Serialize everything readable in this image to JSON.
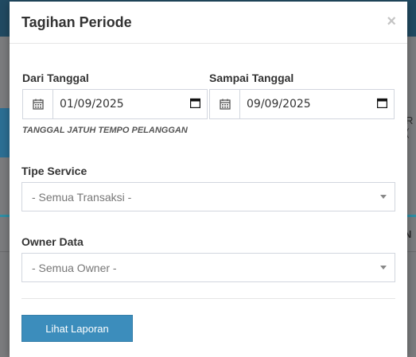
{
  "background": {
    "fragment_right_1": "R (",
    "fragment_right_2": "N I"
  },
  "modal": {
    "title": "Tagihan Periode",
    "close_label": "×"
  },
  "form": {
    "from_date": {
      "label": "Dari Tanggal",
      "value": "01/09/2025"
    },
    "to_date": {
      "label": "Sampai Tanggal",
      "value": "09/09/2025"
    },
    "help_text": "TANGGAL JATUH TEMPO PELANGGAN",
    "service_type": {
      "label": "Tipe Service",
      "selected": "- Semua Transaksi -"
    },
    "owner_data": {
      "label": "Owner Data",
      "selected": "- Semua Owner -"
    },
    "submit_label": "Lihat Laporan"
  },
  "colors": {
    "primary_button": "#3c8dbc",
    "overlay_topbar": "#214a62",
    "accent_line": "#2f8fa5"
  },
  "icons": {
    "date_addon": "calendar-icon",
    "date_picker": "calendar-picker-icon",
    "select_caret": "caret-down-icon"
  }
}
